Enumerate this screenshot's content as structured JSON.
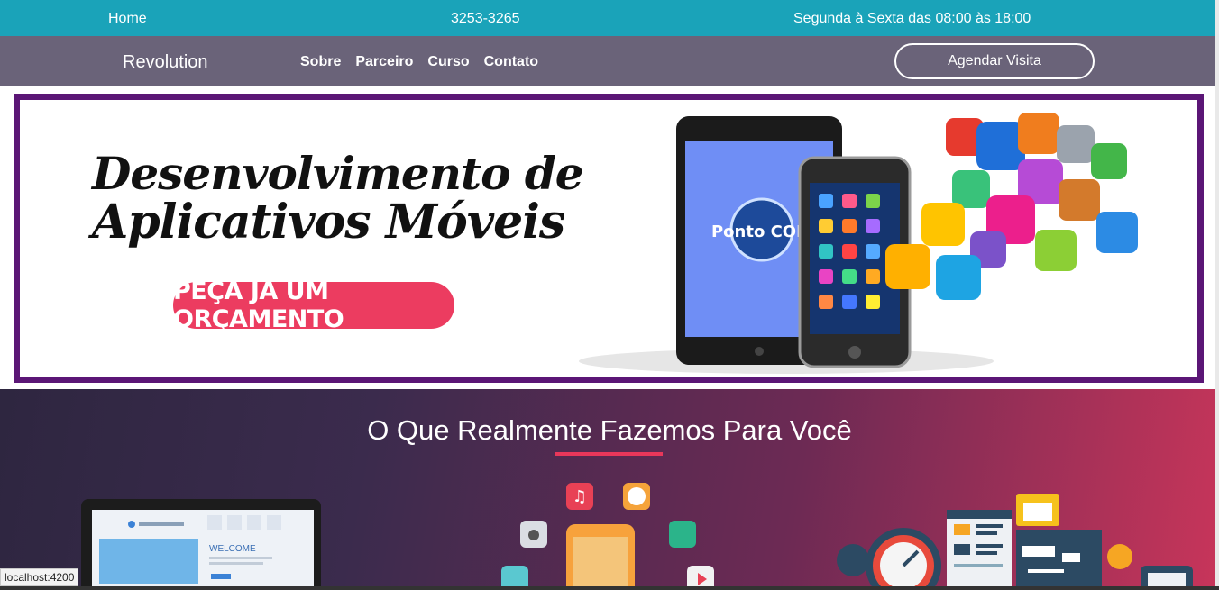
{
  "topbar": {
    "home": "Home",
    "phone": "3253-3265",
    "hours": "Segunda à Sexta das 08:00 às 18:00"
  },
  "navbar": {
    "brand": "Revolution",
    "links": [
      "Sobre",
      "Parceiro",
      "Curso",
      "Contato"
    ],
    "cta": "Agendar Visita"
  },
  "banner": {
    "line1": "Desenvolvimento de",
    "line2": "Aplicativos Móveis",
    "button": "PEÇA JÁ UM ORÇAMENTO",
    "logo": "Ponto COM"
  },
  "services": {
    "heading": "O Que Realmente Fazemos Para Você",
    "laptop_text": "WELCOME"
  },
  "status": {
    "url": "localhost:4200"
  },
  "colors": {
    "topbar": "#1aa3b9",
    "navbar": "#6a6379",
    "banner_border": "#5b1676",
    "accent": "#e8375a"
  }
}
